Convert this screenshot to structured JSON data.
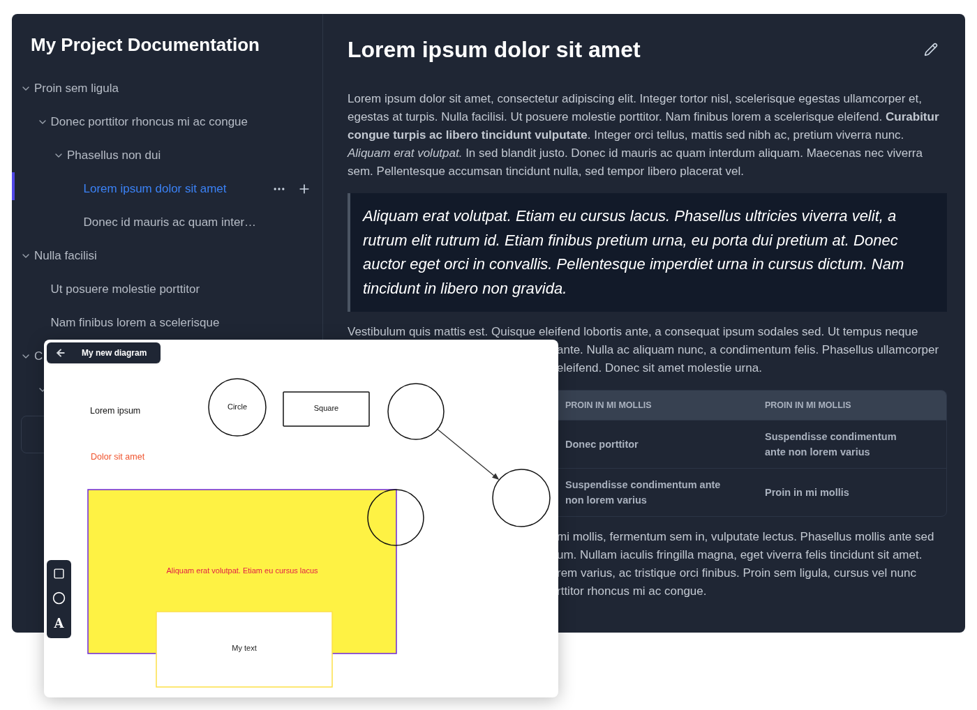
{
  "sidebar": {
    "title": "My Project Documentation",
    "tree": [
      {
        "label": "Proin sem ligula",
        "expanded": true,
        "selected": false,
        "children": [
          {
            "label": "Donec porttitor rhoncus mi ac congue",
            "expanded": true,
            "selected": false,
            "children": [
              {
                "label": "Phasellus non dui",
                "expanded": true,
                "selected": false,
                "children": [
                  {
                    "label": "Lorem ipsum dolor sit amet",
                    "selected": true
                  },
                  {
                    "label": "Donec id mauris ac quam inter…",
                    "selected": false
                  }
                ]
              }
            ]
          }
        ]
      },
      {
        "label": "Nulla facilisi",
        "expanded": true,
        "selected": false,
        "children": [
          {
            "label": "Ut posuere molestie porttitor",
            "selected": false
          },
          {
            "label": "Nam finibus lorem a scelerisque",
            "selected": false
          }
        ]
      },
      {
        "label": "C",
        "expanded": true,
        "selected": false,
        "children": [
          {
            "expanded": true,
            "selected": false
          }
        ]
      }
    ]
  },
  "article": {
    "title": "Lorem ipsum dolor sit amet",
    "blocks": [
      {
        "kind": "paragraph",
        "text": "Lorem ipsum dolor sit amet, consectetur adipiscing elit. Integer tortor nisl, scelerisque egestas ullamcorper et, egestas at turpis. Nulla facilisi. Ut posuere molestie porttitor. Nam finibus lorem a scelerisque eleifend. **Curabitur congue turpis ac libero tincidunt vulputate**. Integer orci tellus, mattis sed nibh ac, pretium viverra nunc. *Aliquam erat volutpat.* In sed blandit justo. Donec id mauris ac quam interdum aliquam. Maecenas nec viverra sem. Pellentesque accumsan tincidunt nulla, sed tempor libero placerat vel."
      },
      {
        "kind": "quote",
        "text": "Aliquam erat volutpat. Etiam eu cursus lacus. Phasellus ultricies viverra velit, a rutrum elit rutrum id. Etiam finibus pretium urna, eu porta dui pretium at. Donec auctor eget orci in convallis. Pellentesque imperdiet urna in cursus dictum. Nam tincidunt in libero non gravida."
      },
      {
        "kind": "lines",
        "lines": [
          {
            "text": "Vestibulum quis mattis est. Quisque eleifend lobortis ante, a consequat ipsum sodales sed. Ut tempus neque",
            "covered": false
          },
          {
            "text": "ante. Nulla ac aliquam nunc, a condimentum felis. Phasellus ullamcorper",
            "covered": true
          },
          {
            "text": "eleifend. Donec sit amet molestie urna.",
            "covered": true
          }
        ]
      },
      {
        "kind": "table",
        "columns": [
          "PROIN IN MI MOLLIS",
          "PROIN IN MI MOLLIS"
        ],
        "rows": [
          [
            "Donec porttitor",
            "Suspendisse condimentum ante non lorem varius"
          ],
          [
            "Suspendisse condimentum ante non lorem varius",
            "Proin in mi mollis"
          ]
        ]
      },
      {
        "kind": "lines",
        "lines": [
          {
            "text": "mi mollis, fermentum sem in, vulputate lectus. Phasellus mollis ante sed",
            "covered": true
          },
          {
            "text": "um. Nullam iaculis fringilla magna, eget viverra felis tincidunt sit amet.",
            "covered": true
          },
          {
            "text": "rem varius, ac tristique orci finibus. Proin sem ligula, cursus vel nunc",
            "covered": true
          },
          {
            "text": "rttitor rhoncus mi ac congue.",
            "covered": true
          }
        ]
      }
    ]
  },
  "diagram": {
    "title": "My new diagram",
    "tools": [
      {
        "kind": "square"
      },
      {
        "kind": "circle"
      },
      {
        "kind": "text",
        "label": "A"
      }
    ],
    "nodes": [
      {
        "kind": "text",
        "label": "Lorem ipsum",
        "color": "#111111"
      },
      {
        "kind": "circle",
        "label": "Circle"
      },
      {
        "kind": "rect",
        "label": "Square"
      },
      {
        "kind": "circle"
      },
      {
        "kind": "circle"
      },
      {
        "kind": "text",
        "label": "Dolor sit amet",
        "color": "#f0532d"
      },
      {
        "kind": "area",
        "label": "Aliquam erat volutpat. Etiam eu cursus lacus",
        "color": "#fef244"
      },
      {
        "kind": "circle"
      },
      {
        "kind": "note",
        "label": "My text"
      }
    ]
  }
}
